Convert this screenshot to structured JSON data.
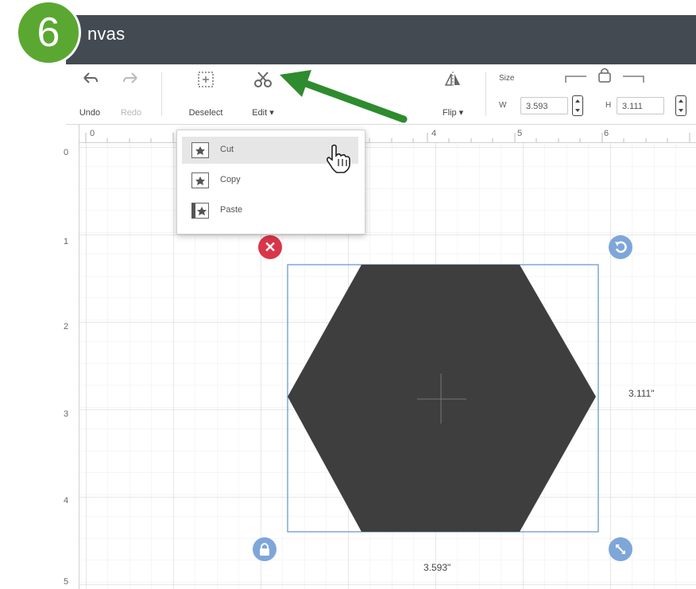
{
  "step_badge": "6",
  "header": {
    "title": "nvas"
  },
  "toolbar": {
    "undo_label": "Undo",
    "redo_label": "Redo",
    "deselect_label": "Deselect",
    "edit_label": "Edit ▾",
    "flip_label": "Flip ▾"
  },
  "size": {
    "label": "Size",
    "w_letter": "W",
    "w_value": "3.593",
    "h_letter": "H",
    "h_value": "3.111"
  },
  "ruler": {
    "top": [
      "0",
      "4",
      "5",
      "6"
    ],
    "left": [
      "0",
      "1",
      "2",
      "3",
      "4",
      "5"
    ]
  },
  "edit_menu": {
    "items": [
      {
        "label": "Cut"
      },
      {
        "label": "Copy"
      },
      {
        "label": "Paste"
      }
    ]
  },
  "measurements": {
    "width": "3.593\"",
    "height": "3.111\""
  },
  "colors": {
    "header_bg": "#434a51",
    "badge": "#5aa832",
    "shape_fill": "#3e3e3e",
    "delete_handle": "#d9364b",
    "selection": "#7ea6d9",
    "arrow": "#2e8b2e"
  },
  "icons": [
    "undo-icon",
    "redo-icon",
    "deselect-icon",
    "edit-icon",
    "flip-icon",
    "lock-icon",
    "pointer-hand-icon",
    "delete-icon",
    "rotate-icon",
    "resize-icon"
  ]
}
